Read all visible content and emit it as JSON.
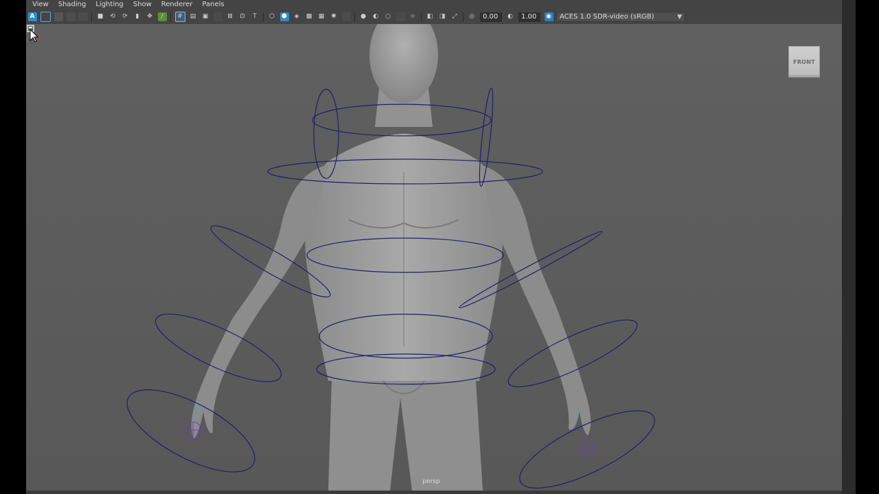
{
  "menubar": {
    "items": [
      "View",
      "Shading",
      "Lighting",
      "Show",
      "Renderer",
      "Panels"
    ]
  },
  "toolbar": {
    "exposure_value": "0.00",
    "gamma_value": "1.00",
    "color_space": "ACES 1.0 SDR-video (sRGB)"
  },
  "viewport": {
    "view_cube_label": "FRONT",
    "camera_label": "persp"
  },
  "colors": {
    "viewport_bg": "#5d5d5d",
    "control_curve": "#1d1f6a",
    "accent_blue": "#29a3d9",
    "highlight_green": "#7fd14a"
  }
}
